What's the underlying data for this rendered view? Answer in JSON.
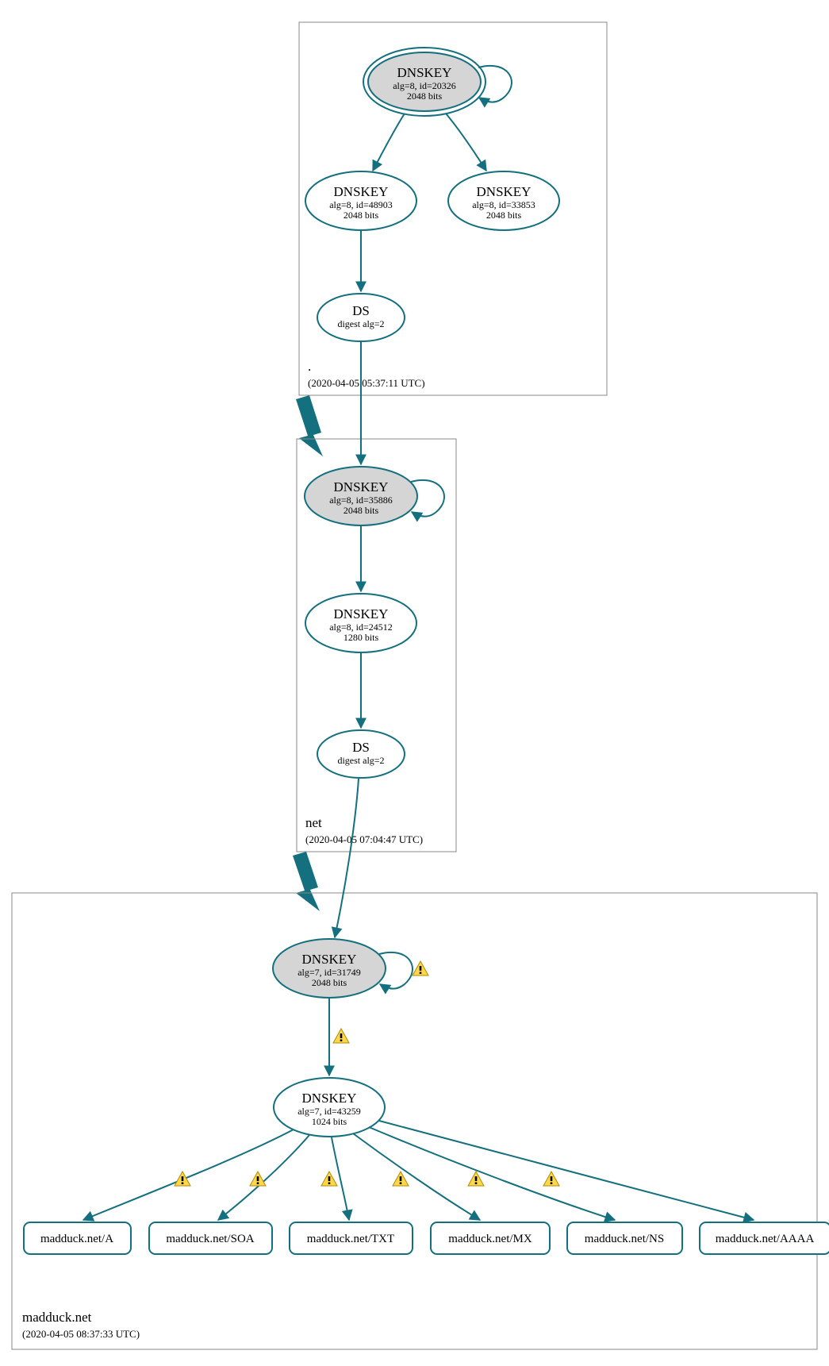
{
  "colors": {
    "teal": "#14707e",
    "gray_fill": "#d5d5d5",
    "box_stroke": "#888888"
  },
  "zones": {
    "root": {
      "name": ".",
      "timestamp": "(2020-04-05 05:37:11 UTC)"
    },
    "net": {
      "name": "net",
      "timestamp": "(2020-04-05 07:04:47 UTC)"
    },
    "madduck": {
      "name": "madduck.net",
      "timestamp": "(2020-04-05 08:37:33 UTC)"
    }
  },
  "nodes": {
    "root_ksk": {
      "title": "DNSKEY",
      "line1": "alg=8, id=20326",
      "line2": "2048 bits"
    },
    "root_zsk1": {
      "title": "DNSKEY",
      "line1": "alg=8, id=48903",
      "line2": "2048 bits"
    },
    "root_zsk2": {
      "title": "DNSKEY",
      "line1": "alg=8, id=33853",
      "line2": "2048 bits"
    },
    "root_ds": {
      "title": "DS",
      "line1": "digest alg=2",
      "line2": ""
    },
    "net_ksk": {
      "title": "DNSKEY",
      "line1": "alg=8, id=35886",
      "line2": "2048 bits"
    },
    "net_zsk": {
      "title": "DNSKEY",
      "line1": "alg=8, id=24512",
      "line2": "1280 bits"
    },
    "net_ds": {
      "title": "DS",
      "line1": "digest alg=2",
      "line2": ""
    },
    "mad_ksk": {
      "title": "DNSKEY",
      "line1": "alg=7, id=31749",
      "line2": "2048 bits"
    },
    "mad_zsk": {
      "title": "DNSKEY",
      "line1": "alg=7, id=43259",
      "line2": "1024 bits"
    }
  },
  "records": {
    "a": "madduck.net/A",
    "soa": "madduck.net/SOA",
    "txt": "madduck.net/TXT",
    "mx": "madduck.net/MX",
    "ns": "madduck.net/NS",
    "aaaa": "madduck.net/AAAA"
  }
}
